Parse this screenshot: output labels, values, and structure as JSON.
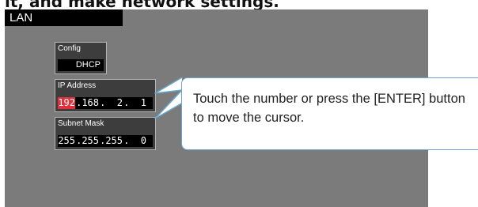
{
  "doc": {
    "heading": "it, and make network settings."
  },
  "window": {
    "title": "LAN"
  },
  "config": {
    "label": "Config",
    "value": "DHCP"
  },
  "ip_address": {
    "label": "IP Address",
    "octets": [
      "192",
      ".168",
      ".  2",
      ".  1"
    ],
    "selected_index": 0
  },
  "subnet_mask": {
    "label": "Subnet Mask",
    "octets": [
      "255",
      ".255",
      ".255",
      ".  0"
    ]
  },
  "callout": {
    "text": "Touch the number or press the [ENTER] button to move the cursor."
  },
  "colors": {
    "screen_bg": "#7b7b7b",
    "panel_bg": "#3d3d3d",
    "field_bg": "#000000",
    "cursor_highlight": "#e0303c",
    "callout_border": "#6aa7cf"
  }
}
